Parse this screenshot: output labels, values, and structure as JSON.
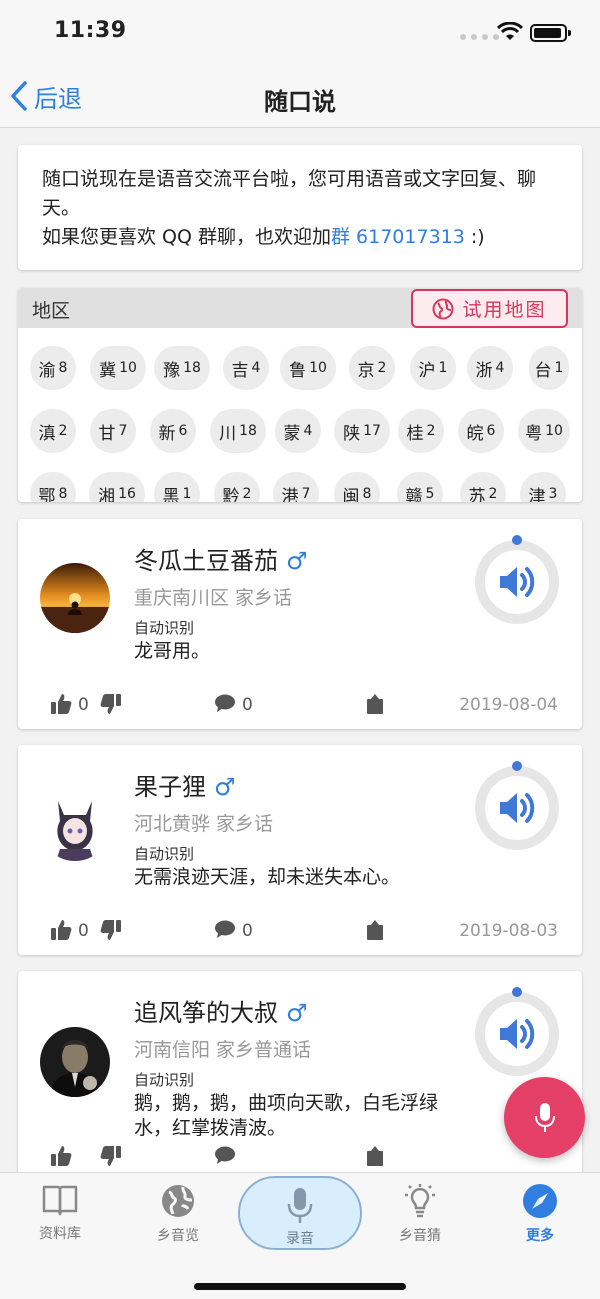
{
  "status": {
    "time": "11:39"
  },
  "nav": {
    "back_label": "后退",
    "title": "随口说"
  },
  "notice": {
    "line1": "随口说现在是语音交流平台啦，您可用语音或文字回复、聊天。",
    "line2_prefix": "如果您更喜欢 QQ 群聊，也欢迎加",
    "qq_link": "群 617017313",
    "line2_suffix": " :)"
  },
  "regions": {
    "title": "地区",
    "map_button": "试用地图",
    "items": [
      {
        "name": "渝",
        "count": "8"
      },
      {
        "name": "冀",
        "count": "10"
      },
      {
        "name": "豫",
        "count": "18"
      },
      {
        "name": "吉",
        "count": "4"
      },
      {
        "name": "鲁",
        "count": "10"
      },
      {
        "name": "京",
        "count": "2"
      },
      {
        "name": "沪",
        "count": "1"
      },
      {
        "name": "浙",
        "count": "4"
      },
      {
        "name": "台",
        "count": "1"
      },
      {
        "name": "滇",
        "count": "2"
      },
      {
        "name": "甘",
        "count": "7"
      },
      {
        "name": "新",
        "count": "6"
      },
      {
        "name": "川",
        "count": "18"
      },
      {
        "name": "蒙",
        "count": "4"
      },
      {
        "name": "陕",
        "count": "17"
      },
      {
        "name": "桂",
        "count": "2"
      },
      {
        "name": "皖",
        "count": "6"
      },
      {
        "name": "粤",
        "count": "10"
      },
      {
        "name": "鄂",
        "count": "8"
      },
      {
        "name": "湘",
        "count": "16"
      },
      {
        "name": "黑",
        "count": "1"
      },
      {
        "name": "黔",
        "count": "2"
      },
      {
        "name": "港",
        "count": "7"
      },
      {
        "name": "闽",
        "count": "8"
      },
      {
        "name": "赣",
        "count": "5"
      },
      {
        "name": "苏",
        "count": "2"
      },
      {
        "name": "津",
        "count": "3"
      }
    ]
  },
  "posts": [
    {
      "name": "冬瓜土豆番茄",
      "gender": "♂",
      "location": "重庆南川区 家乡话",
      "auto_label": "自动识别",
      "text": "龙哥用。",
      "likes": "0",
      "comments": "0",
      "date": "2019-08-04"
    },
    {
      "name": "果子狸",
      "gender": "♂",
      "location": "河北黄骅 家乡话",
      "auto_label": "自动识别",
      "text": "无需浪迹天涯，却未迷失本心。",
      "likes": "0",
      "comments": "0",
      "date": "2019-08-03"
    },
    {
      "name": "追风筝的大叔",
      "gender": "♂",
      "location": "河南信阳 家乡普通话",
      "auto_label": "自动识别",
      "text": "鹅，鹅，鹅，曲项向天歌，白毛浮绿水，红掌拨清波。",
      "likes": "",
      "comments": "",
      "date": ""
    }
  ],
  "tabs": [
    {
      "label": "资料库",
      "icon": "book-icon"
    },
    {
      "label": "乡音览",
      "icon": "globe-icon"
    },
    {
      "label": "录音",
      "icon": "microphone-icon"
    },
    {
      "label": "乡音猜",
      "icon": "lightbulb-icon"
    },
    {
      "label": "更多",
      "icon": "compass-icon"
    }
  ],
  "colors": {
    "accent": "#2f7ee0",
    "record_red": "#e43f67",
    "map_red": "#d7375e"
  }
}
